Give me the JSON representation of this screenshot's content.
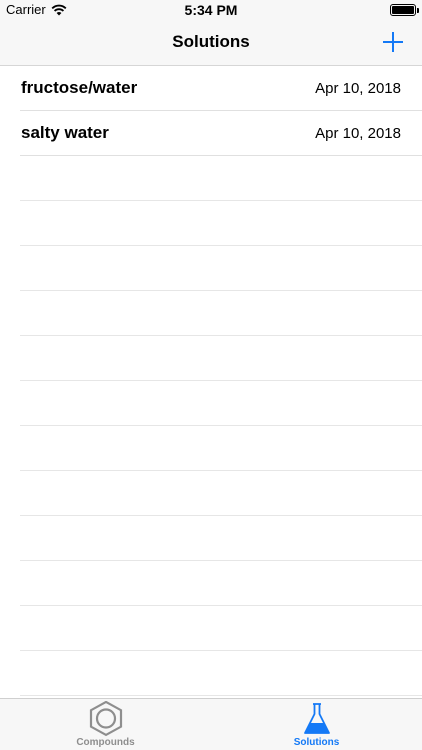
{
  "status_bar": {
    "carrier": "Carrier",
    "time": "5:34 PM"
  },
  "nav": {
    "title": "Solutions",
    "add_icon": "plus-icon"
  },
  "solutions": [
    {
      "name": "fructose/water",
      "date": "Apr 10, 2018"
    },
    {
      "name": "salty water",
      "date": "Apr 10, 2018"
    }
  ],
  "tabs": [
    {
      "label": "Compounds",
      "icon": "benzene-ring-icon",
      "active": false
    },
    {
      "label": "Solutions",
      "icon": "flask-icon",
      "active": true
    }
  ],
  "colors": {
    "accent": "#1479f6",
    "inactive": "#8e8e8e",
    "bar_background": "#f7f7f7"
  }
}
